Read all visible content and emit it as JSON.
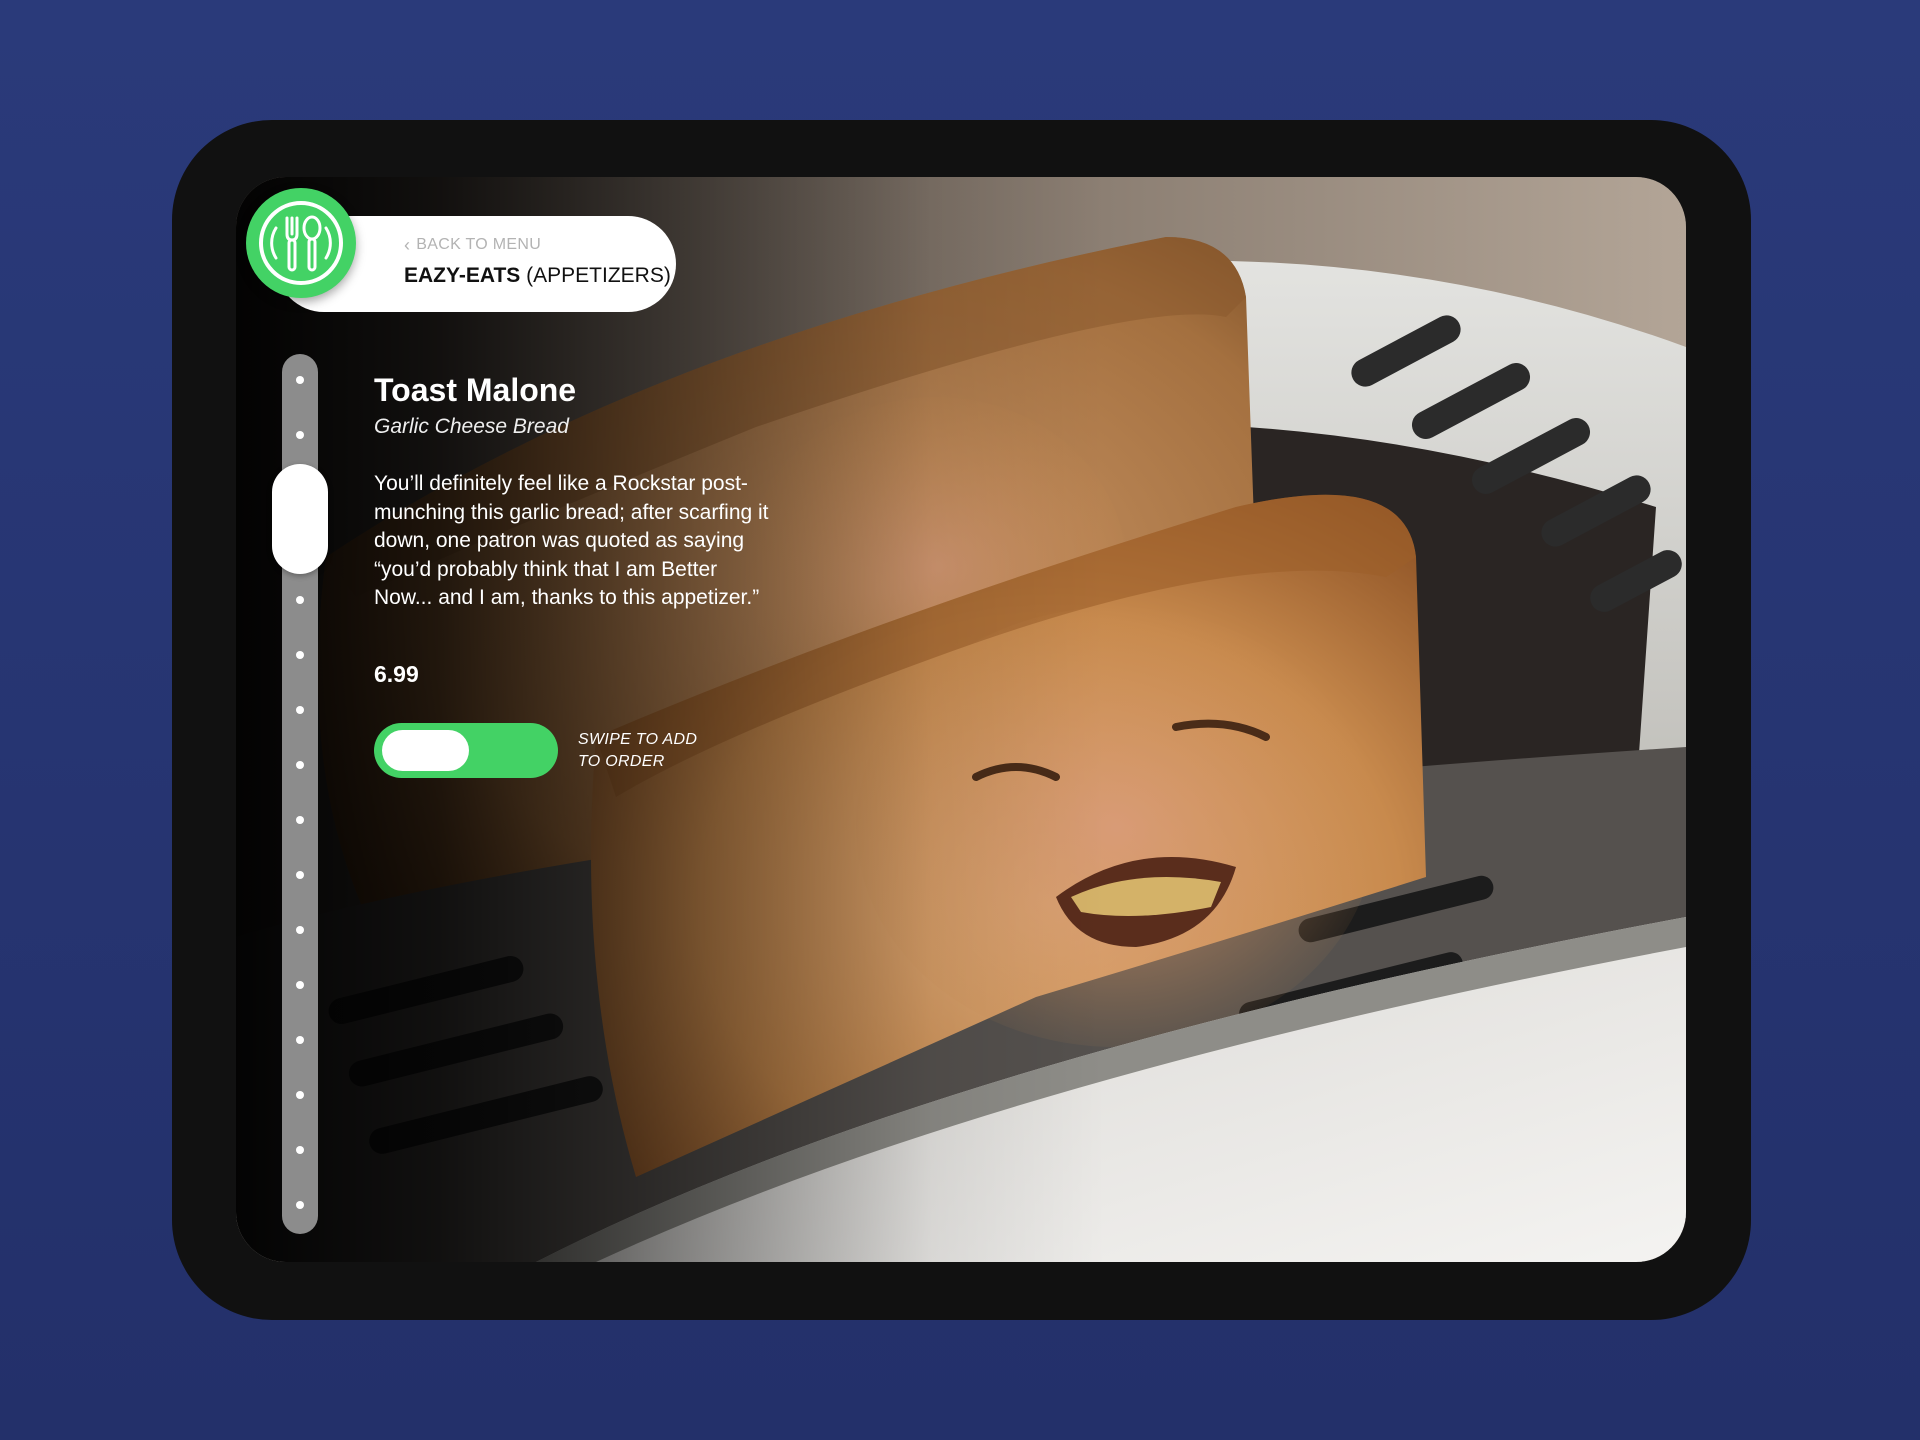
{
  "header": {
    "back_label": "BACK TO MENU",
    "brand": "EAZY-EATS",
    "category": "(APPETIZERS)"
  },
  "icons": {
    "logo": "fork-spoon-icon",
    "back": "chevron-left-icon"
  },
  "colors": {
    "accent_green": "#43d265",
    "background_navy": "#26336f",
    "device_frame": "#111111"
  },
  "item": {
    "name": "Toast Malone",
    "subtitle": "Garlic Cheese Bread",
    "description": "You’ll definitely feel like a Rockstar post-munching this garlic bread; after scarfing it down, one patron was quoted as saying “you’d probably think that I am Better Now... and I am, thanks to this appetizer.”",
    "price": "6.99"
  },
  "order": {
    "swipe_label": "SWIPE TO ADD TO ORDER"
  },
  "scroller": {
    "item_count": 16,
    "active_index": 2
  }
}
